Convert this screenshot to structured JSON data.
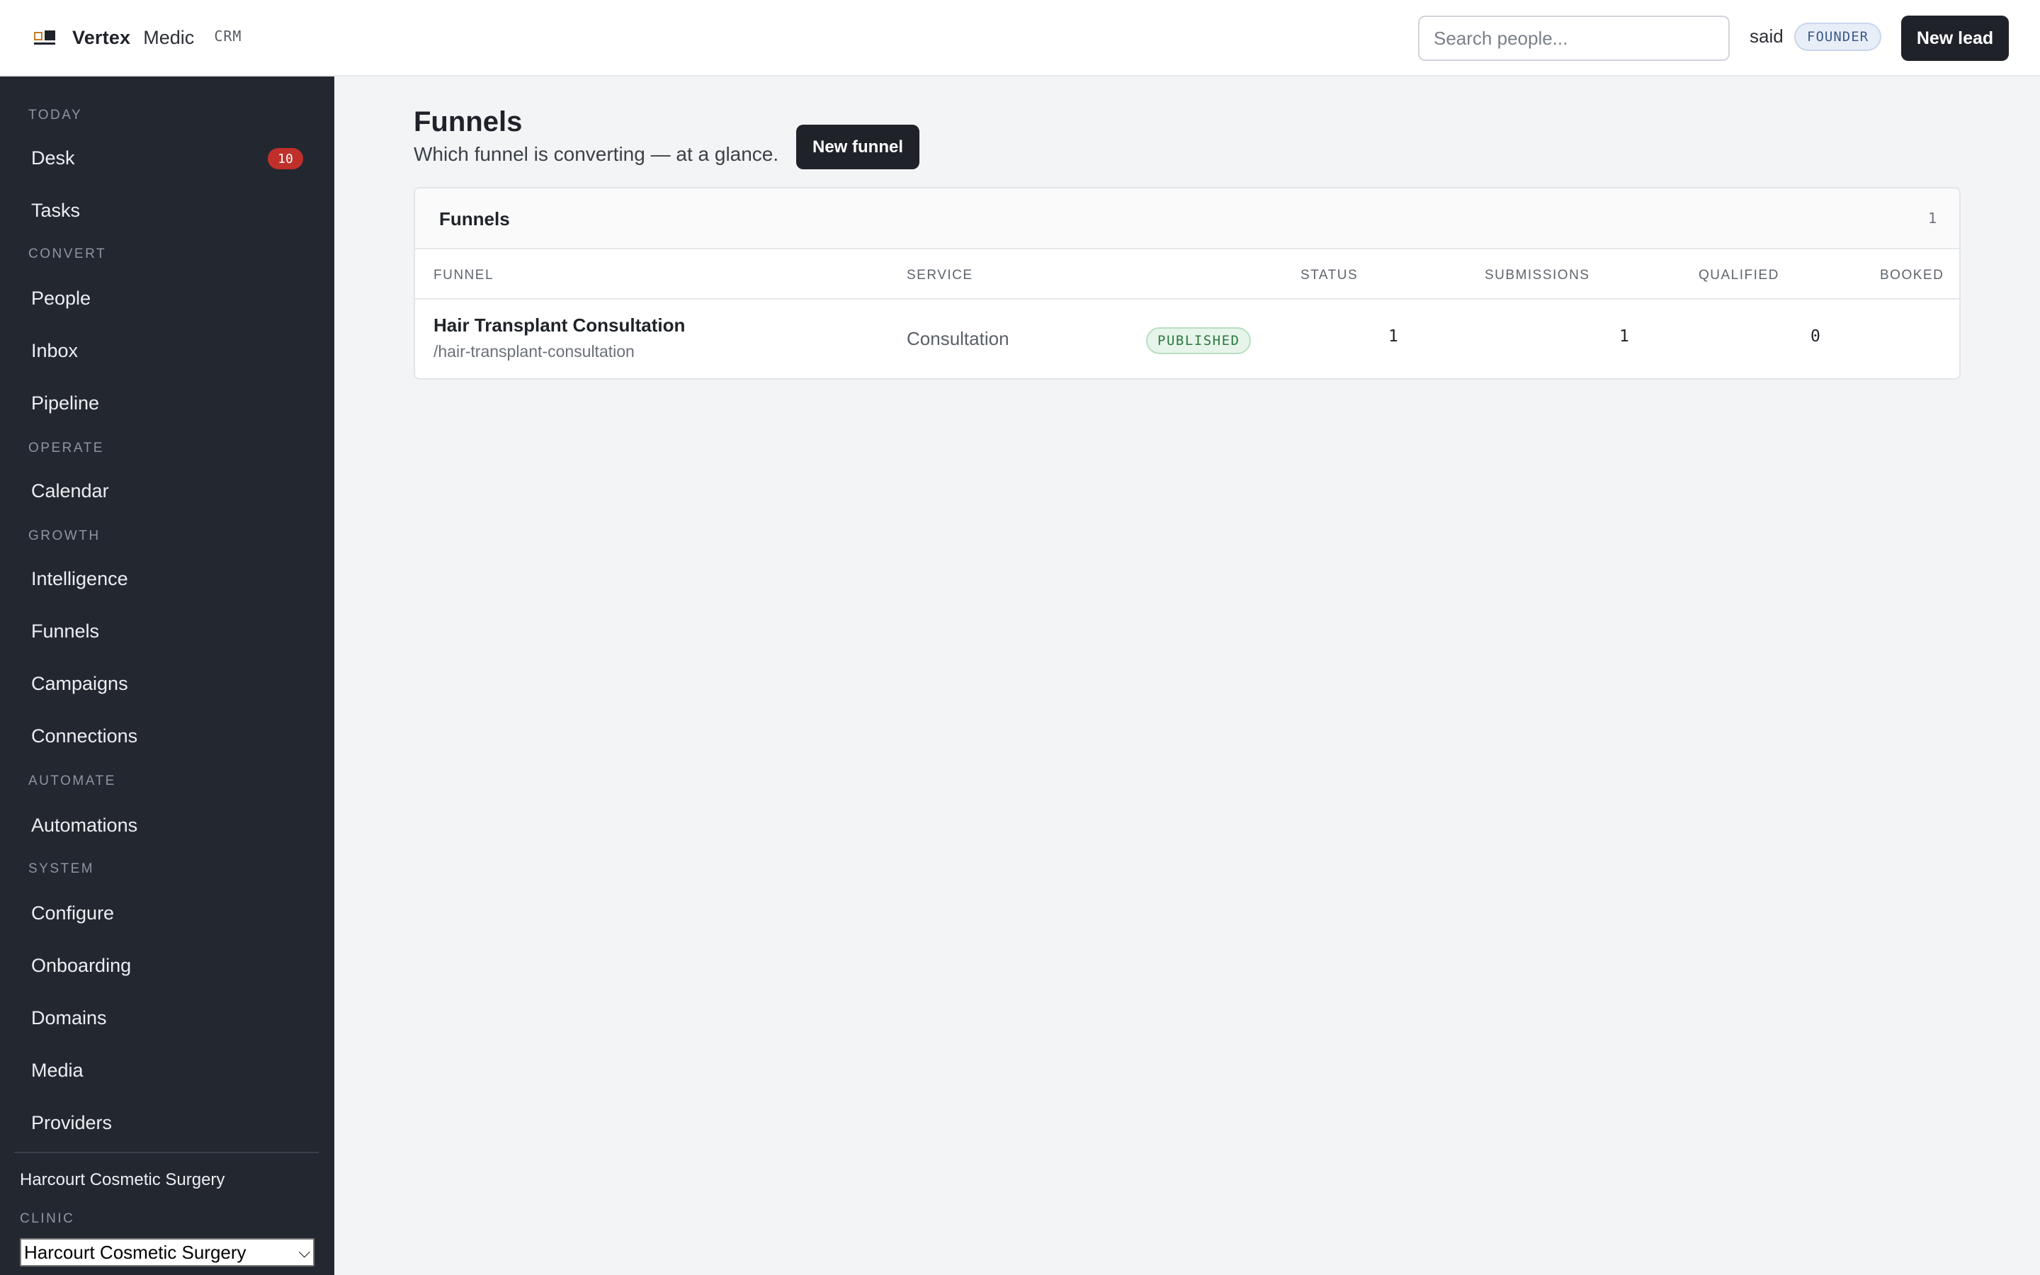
{
  "app": {
    "brand_name": "Vertex",
    "brand_sub": "Medic",
    "brand_tag": "CRM"
  },
  "header": {
    "search_placeholder": "Search people...",
    "user_name": "said",
    "user_role": "FOUNDER",
    "new_lead_label": "New lead"
  },
  "sidebar": {
    "sections": {
      "today": "TODAY",
      "convert": "CONVERT",
      "operate": "OPERATE",
      "growth": "GROWTH",
      "automate": "AUTOMATE",
      "system": "SYSTEM"
    },
    "items": {
      "desk": "Desk",
      "desk_badge": "10",
      "tasks": "Tasks",
      "people": "People",
      "inbox": "Inbox",
      "pipeline": "Pipeline",
      "calendar": "Calendar",
      "intelligence": "Intelligence",
      "funnels": "Funnels",
      "campaigns": "Campaigns",
      "connections": "Connections",
      "automations": "Automations",
      "configure": "Configure",
      "onboarding": "Onboarding",
      "domains": "Domains",
      "media": "Media",
      "providers": "Providers"
    },
    "clinic": {
      "name": "Harcourt Cosmetic Surgery",
      "label": "CLINIC",
      "selected": "Harcourt Cosmetic Surgery"
    }
  },
  "main": {
    "title": "Funnels",
    "subtitle": "Which funnel is converting — at a glance.",
    "new_funnel_label": "New funnel",
    "card": {
      "title": "Funnels",
      "count": "1",
      "columns": {
        "funnel": "FUNNEL",
        "service": "SERVICE",
        "status": "STATUS",
        "submissions": "SUBMISSIONS",
        "qualified": "QUALIFIED",
        "booked": "BOOKED"
      },
      "rows": [
        {
          "name": "Hair Transplant Consultation",
          "slug": "/hair-transplant-consultation",
          "service": "Consultation",
          "status": "PUBLISHED",
          "submissions": "1",
          "qualified": "1",
          "booked": "0"
        }
      ]
    }
  }
}
